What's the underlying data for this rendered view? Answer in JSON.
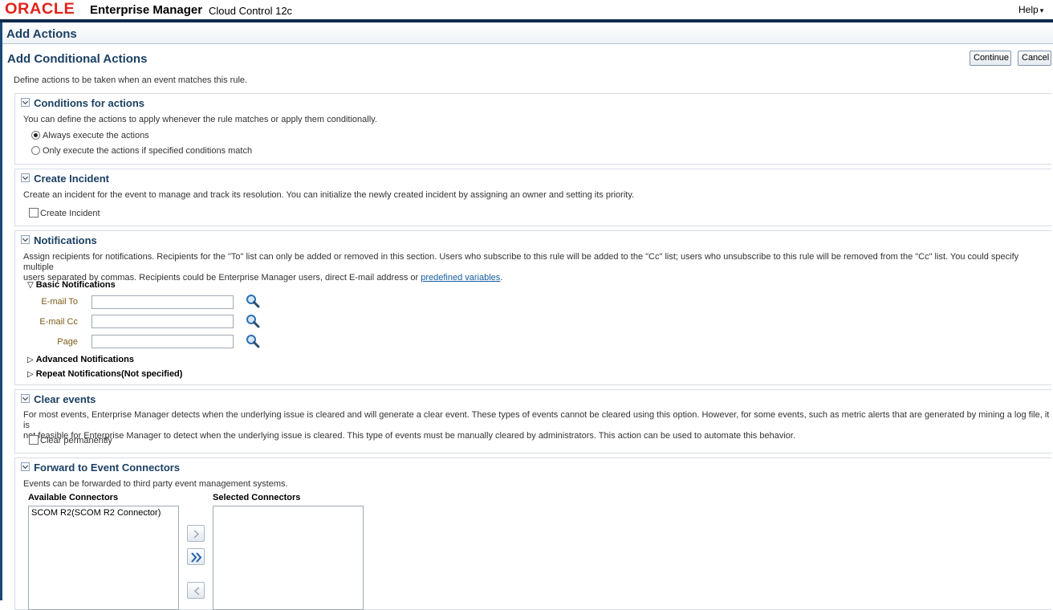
{
  "header": {
    "brand": "ORACLE",
    "product": "Enterprise Manager",
    "edition": "Cloud Control 12c",
    "help_label": "Help",
    "help_caret": "▾"
  },
  "page": {
    "title": "Add Actions",
    "subtitle": "Add Conditional Actions",
    "continue_label": "Continue",
    "cancel_label": "Cancel",
    "description": "Define actions to be taken when an event matches this rule."
  },
  "conditions": {
    "title": "Conditions for actions",
    "text": "You can define the actions to apply whenever the rule matches or apply them conditionally.",
    "options": [
      {
        "label": "Always execute the actions",
        "selected": true
      },
      {
        "label": "Only execute the actions if specified conditions match",
        "selected": false
      }
    ]
  },
  "incident": {
    "title": "Create Incident",
    "text": "Create an incident for the event to manage and track its resolution. You can initialize the newly created incident by assigning an owner and setting its priority.",
    "checkbox_label": "Create Incident",
    "checked": false
  },
  "notifications": {
    "title": "Notifications",
    "text_line1": "Assign recipients for notifications. Recipients for the \"To\" list can only be added or removed in this section. Users who subscribe to this rule will be added to the \"Cc\" list; users who unsubscribe to this rule will be removed from the \"Cc\" list. You could specify multiple",
    "text_line2": "users separated by commas. Recipients could be Enterprise Manager users, direct E-mail address or ",
    "link_text": "predefined variables",
    "link_suffix": ".",
    "basic_label": "Basic Notifications",
    "basic_arrow": "▽",
    "fields": [
      {
        "label": "E-mail To",
        "value": ""
      },
      {
        "label": "E-mail Cc",
        "value": ""
      },
      {
        "label": "Page",
        "value": ""
      }
    ],
    "advanced_label": "Advanced Notifications",
    "repeat_label": "Repeat Notifications(Not specified)",
    "collapsed_arrow": "▷"
  },
  "clear_events": {
    "title": "Clear events",
    "text_line1": "For most events, Enterprise Manager detects when the underlying issue is cleared and will generate a clear event. These types of events cannot be cleared using this option. However, for some events, such as metric alerts that are generated by mining a log file, it is",
    "text_line2": "not feasible for Enterprise Manager to detect when the underlying issue is cleared. This type of events must be manually cleared by administrators. This action can be used to automate this behavior.",
    "checkbox_label": "Clear permanently",
    "checked": false
  },
  "connectors": {
    "title": "Forward to Event Connectors",
    "text": "Events can be forwarded to third party event management systems.",
    "available_label": "Available Connectors",
    "selected_label": "Selected Connectors",
    "available_items": [
      "SCOM R2(SCOM R2 Connector)"
    ],
    "selected_items": []
  },
  "colors": {
    "heading": "#1b4063",
    "brand_red": "#e2231a",
    "link": "#145c9e",
    "field_label": "#7d5b17"
  }
}
